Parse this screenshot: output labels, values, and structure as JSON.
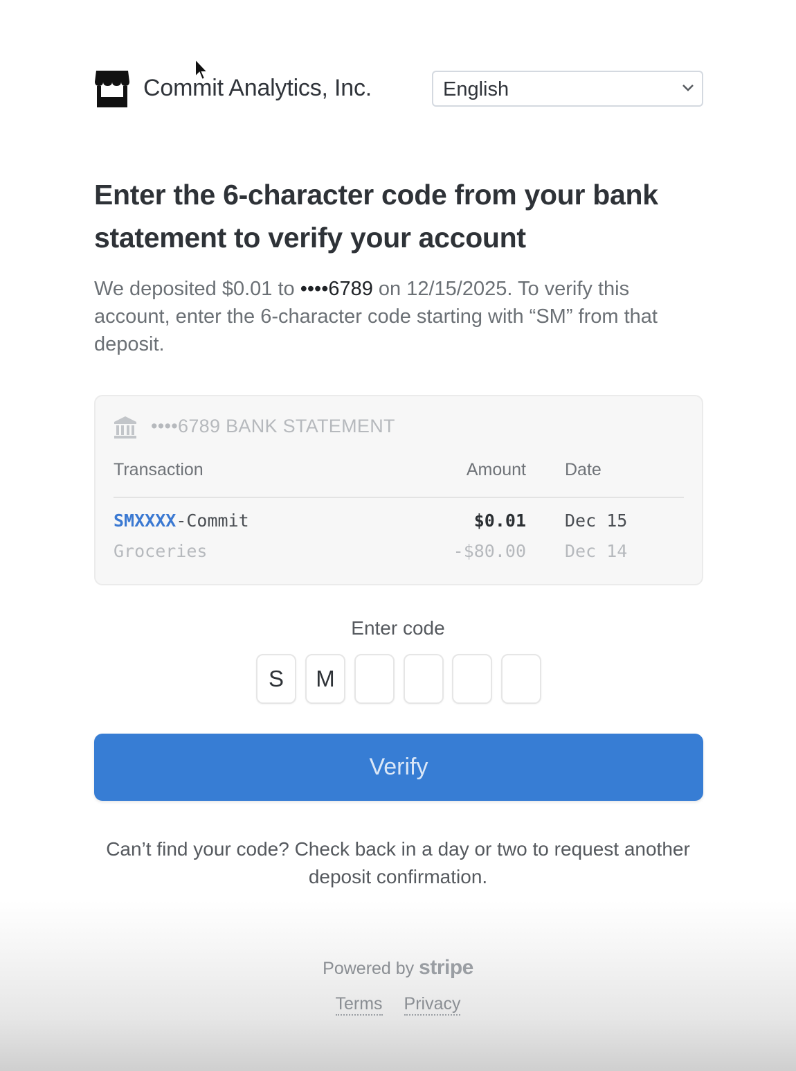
{
  "header": {
    "company_name": "Commit Analytics, Inc.",
    "language_selected": "English",
    "logo_icon": "storefront-icon"
  },
  "main": {
    "heading": "Enter the 6-character code from your bank statement to verify your account",
    "description_prefix": "We deposited $0.01 to ",
    "description_account": "••••6789",
    "description_suffix": " on 12/15/2025. To verify this account, enter the 6-character code starting with “SM” from that deposit."
  },
  "statement": {
    "icon": "bank-icon",
    "title": "••••6789 BANK STATEMENT",
    "columns": [
      "Transaction",
      "Amount",
      "Date"
    ],
    "rows": [
      {
        "code": "SMXXXX",
        "description": "-Commit",
        "amount": "$0.01",
        "date": "Dec 15"
      },
      {
        "code": "",
        "description": "Groceries",
        "amount": "-$80.00",
        "date": "Dec 14"
      }
    ]
  },
  "code_entry": {
    "label": "Enter code",
    "chars": [
      "S",
      "M",
      "",
      "",
      "",
      ""
    ]
  },
  "actions": {
    "verify_label": "Verify"
  },
  "help_text": "Can’t find your code? Check back in a day or two to request another deposit confirmation.",
  "footer": {
    "powered_by": "Powered by",
    "brand": "stripe",
    "terms": "Terms",
    "privacy": "Privacy"
  },
  "colors": {
    "accent": "#377dd4",
    "code_highlight": "#3b79d2"
  }
}
